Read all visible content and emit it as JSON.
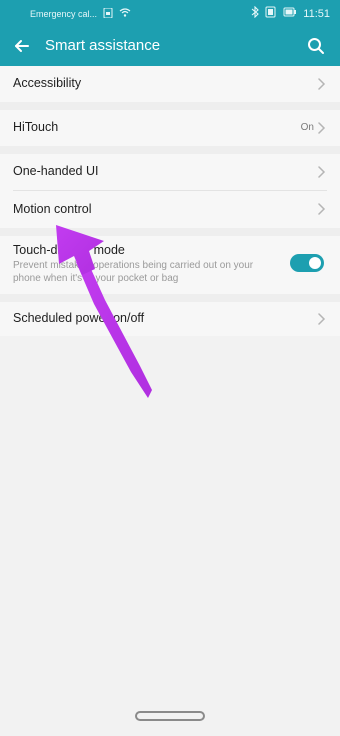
{
  "status_bar": {
    "carrier": "Emergency cal...",
    "time": "11:51"
  },
  "header": {
    "title": "Smart assistance"
  },
  "items": [
    {
      "label": "Accessibility"
    },
    {
      "label": "HiTouch",
      "value": "On"
    },
    {
      "label": "One-handed UI"
    },
    {
      "label": "Motion control"
    },
    {
      "label": "Touch-disable mode",
      "description": "Prevent mistaken operations being carried out on your phone when it's in your pocket or bag",
      "enabled": true
    },
    {
      "label": "Scheduled power on/off"
    }
  ],
  "colors": {
    "accent": "#1d9fb0",
    "annotation": "#c23cf0"
  }
}
